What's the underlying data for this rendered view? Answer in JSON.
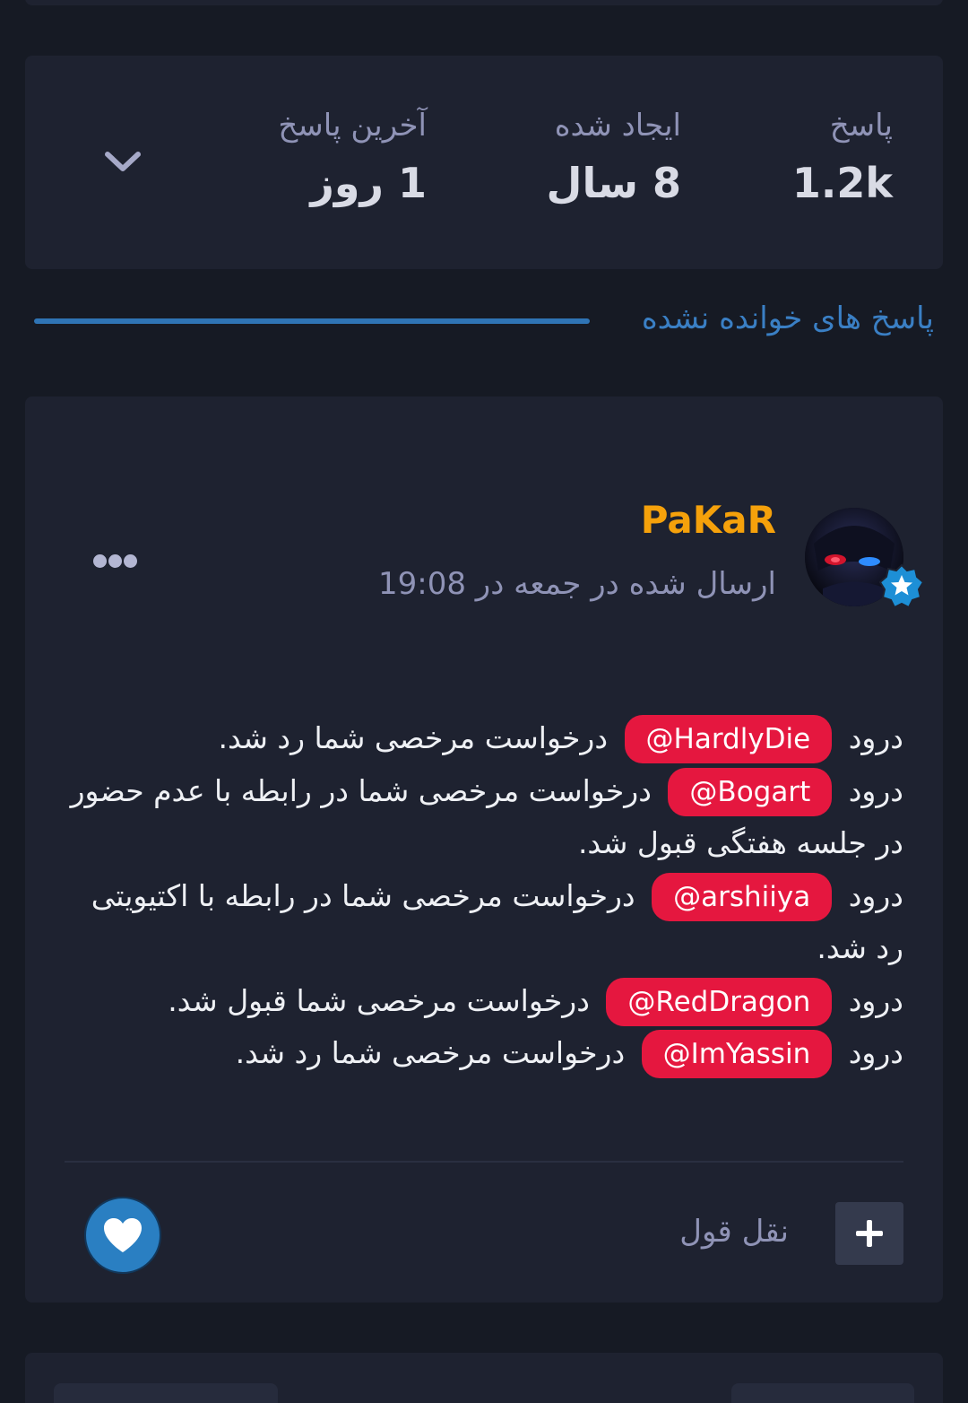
{
  "stats": {
    "replies_label": "پاسخ",
    "replies_value": "1.2k",
    "created_label": "ایجاد شده",
    "created_value": "8 سال",
    "last_reply_label": "آخرین پاسخ",
    "last_reply_value": "1 روز",
    "expand_icon": "chevron-down-icon"
  },
  "unread": {
    "label": "پاسخ های خوانده نشده"
  },
  "post": {
    "author": "PaKaR",
    "author_color": "#f5a10b",
    "meta": "ارسال شده در جمعه در 19:08",
    "badge_icon": "star-badge-icon",
    "menu_icon": "more-dots-icon",
    "lines": [
      {
        "greeting": "درود",
        "mention": "HardlyDie@",
        "text": "درخواست مرخصی شما رد شد."
      },
      {
        "greeting": "درود",
        "mention": "Bogart@",
        "text": "درخواست مرخصی شما در رابطه با عدم حضور در جلسه هفتگی قبول شد."
      },
      {
        "greeting": "درود",
        "mention": "arshiiya@",
        "text": "درخواست مرخصی شما در رابطه با اکتیویتی رد شد."
      },
      {
        "greeting": "درود",
        "mention": "RedDragon@",
        "text": "درخواست مرخصی شما قبول شد."
      },
      {
        "greeting": "درود",
        "mention": "ImYassin@",
        "text": "درخواست مرخصی شما رد شد."
      }
    ],
    "quote_label": "نقل قول",
    "plus_icon": "plus-icon",
    "like_icon": "heart-icon",
    "mention_color": "#e5173f",
    "accent_color": "#2a7fc2"
  }
}
